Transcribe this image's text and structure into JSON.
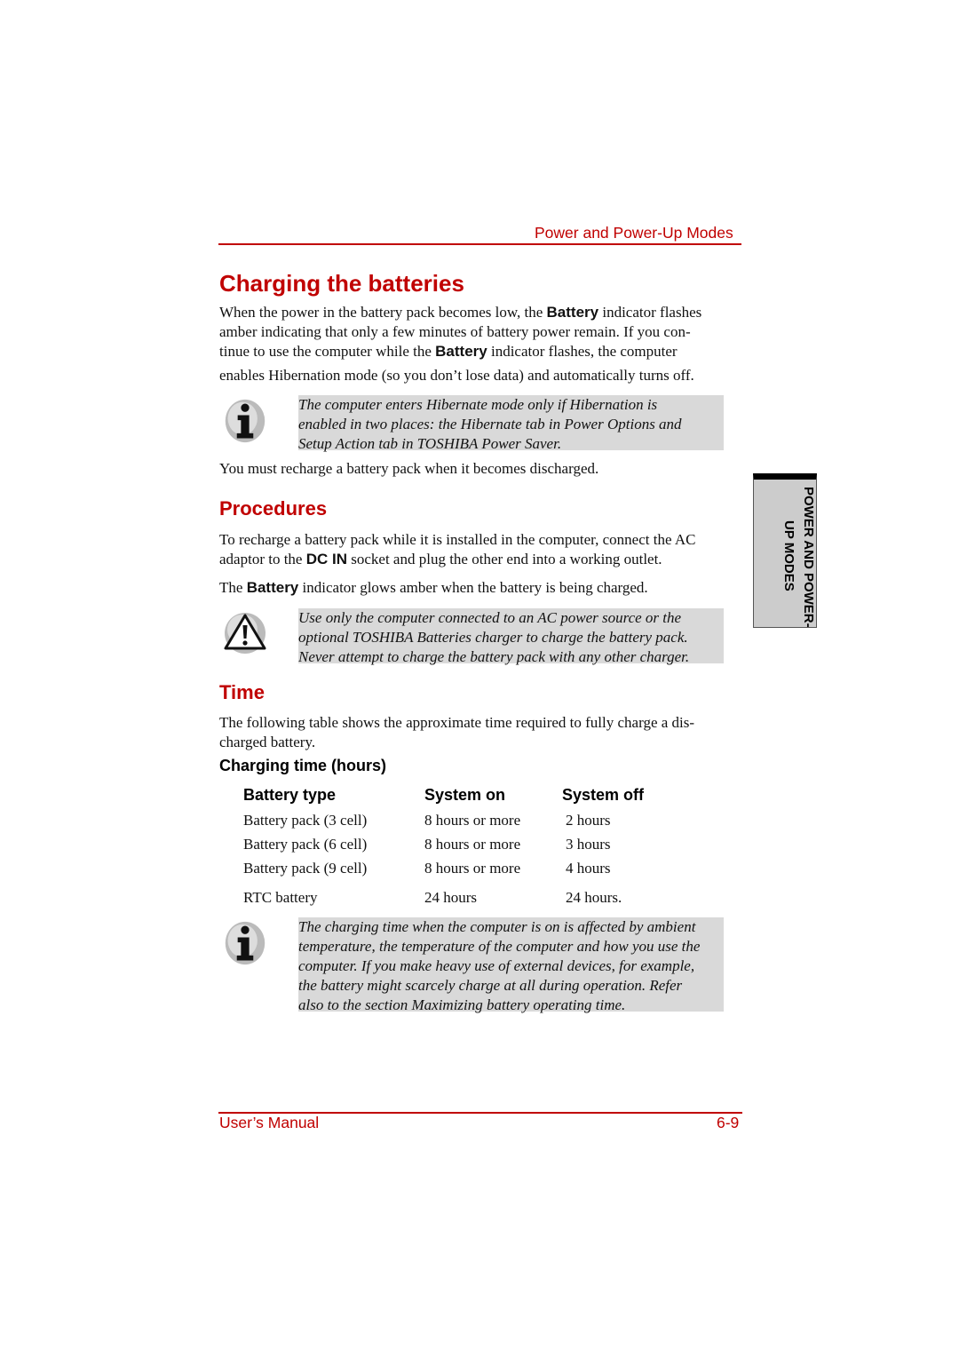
{
  "header": {
    "title": "Power and Power-Up Modes"
  },
  "side_tab": {
    "line1": "POWER AND POWER-",
    "line2": "UP MODES"
  },
  "section1": {
    "heading": "Charging the batteries",
    "p1": {
      "l1a": "When the power in the battery pack becomes low, the ",
      "l1b": "Battery",
      "l1c": " indicator flashes",
      "l2": "amber indicating that only a few minutes of battery power remain. If you con-",
      "l3a": "tinue to use the computer while the ",
      "l3b": "Battery",
      "l3c": " indicator flashes, the computer",
      "l4": "enables Hibernation mode (so you don’t lose data) and automatically turns off."
    },
    "note": [
      "The computer enters Hibernate mode only if Hibernation is",
      "enabled in two places: the Hibernate tab in Power Options and",
      "Setup Action tab in TOSHIBA Power Saver."
    ],
    "p2": "You must recharge a battery pack when it becomes discharged."
  },
  "procedures": {
    "heading": "Procedures",
    "p1": {
      "l1": "To recharge a battery pack while it is installed in the computer, connect the AC",
      "l2a": "adaptor to the ",
      "l2b": "DC IN",
      "l2c": " socket and plug the other end into a working outlet."
    },
    "p2": {
      "a": "The ",
      "b": "Battery",
      "c": " indicator glows amber when the battery is being charged."
    },
    "warning": [
      "Use only the computer connected to an AC power source or the",
      "optional TOSHIBA Batteries charger to charge the battery pack.",
      "Never attempt to charge the battery pack with any other charger."
    ]
  },
  "time": {
    "heading": "Time",
    "p1": [
      "The following table shows the approximate time required to fully charge a dis-",
      "charged battery."
    ],
    "table_title": "Charging time (hours)",
    "columns": [
      "Battery type",
      "System on",
      "System off"
    ],
    "rows": [
      [
        "Battery pack (3 cell)",
        "8 hours or more",
        "2 hours"
      ],
      [
        "Battery pack (6 cell)",
        "8 hours or more",
        "3 hours"
      ],
      [
        "Battery pack (9 cell)",
        "8 hours or more",
        "4 hours"
      ],
      [
        "RTC battery",
        "24 hours",
        "24 hours."
      ]
    ],
    "note": [
      "The charging time when the computer is on is affected by ambient",
      "temperature, the temperature of the computer and how you use the",
      "computer. If you make heavy use of external devices, for example,",
      "the battery might scarcely charge at all during operation. Refer",
      "also to the section Maximizing battery operating time."
    ]
  },
  "footer": {
    "left": "User’s Manual",
    "right": "6-9"
  },
  "colors": {
    "accent": "#c00000",
    "note_bg": "#d9d9d9",
    "tab_bg": "#cccccc"
  }
}
